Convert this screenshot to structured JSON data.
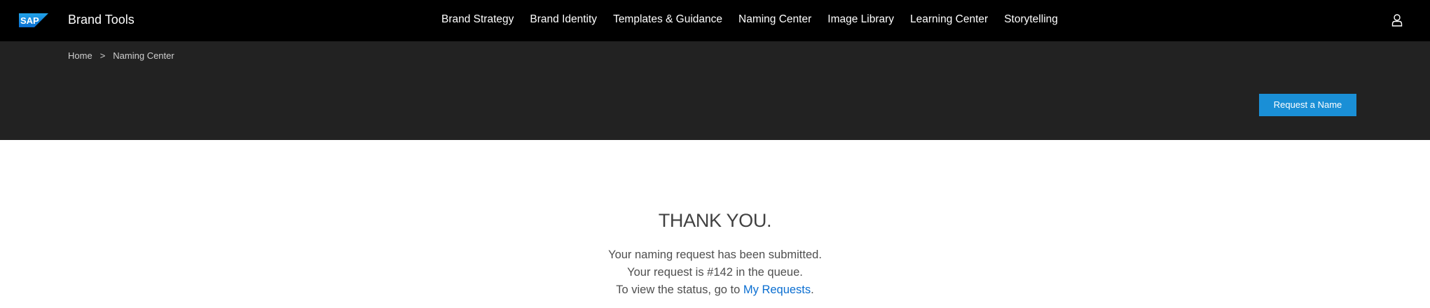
{
  "header": {
    "logo_text": "SAP",
    "title": "Brand Tools",
    "nav": [
      {
        "label": "Brand Strategy"
      },
      {
        "label": "Brand Identity"
      },
      {
        "label": "Templates & Guidance"
      },
      {
        "label": "Naming Center"
      },
      {
        "label": "Image Library"
      },
      {
        "label": "Learning Center"
      },
      {
        "label": "Storytelling"
      }
    ],
    "user_icon": "user-icon"
  },
  "breadcrumb": {
    "home": "Home",
    "separator": ">",
    "current": "Naming Center"
  },
  "hero": {
    "request_button_label": "Request a Name"
  },
  "confirmation": {
    "heading": "THANK YOU.",
    "line1": "Your naming request has been submitted.",
    "line2": "Your request is #142 in the queue.",
    "line3_prefix": "To view the status, go to ",
    "line3_link": "My Requests",
    "line3_suffix": "."
  },
  "colors": {
    "topbar": "#000000",
    "hero": "#222222",
    "accent_button": "#1a8fd6",
    "link": "#0a6ed1"
  }
}
